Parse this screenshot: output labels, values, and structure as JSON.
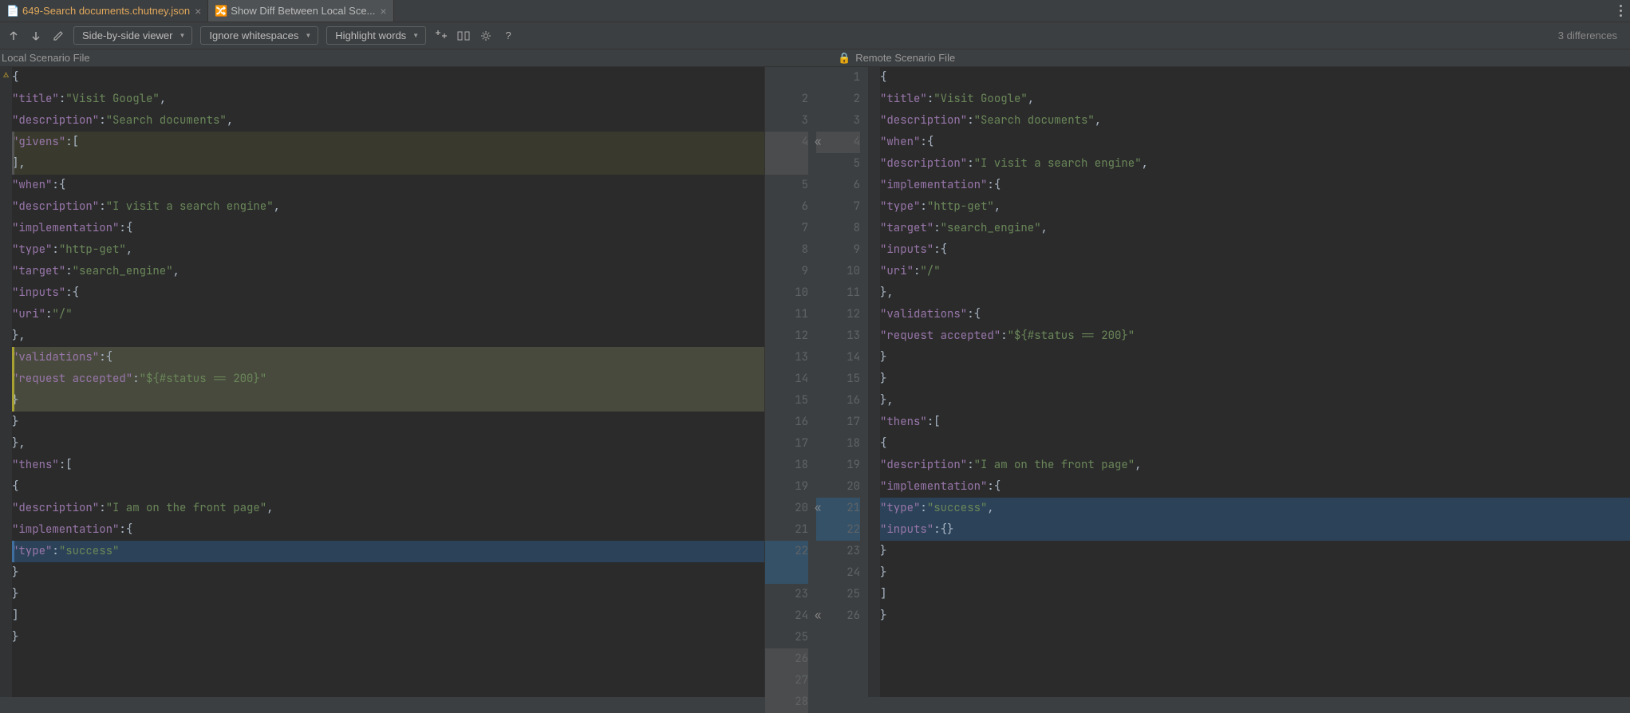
{
  "tabs": [
    {
      "label": "649-Search documents.chutney.json",
      "active": false
    },
    {
      "label": "Show Diff Between Local Sce...",
      "active": true
    }
  ],
  "toolbar": {
    "prev_diff": "↑",
    "next_diff": "↓",
    "viewer_select": "Side-by-side viewer",
    "whitespace_select": "Ignore whitespaces",
    "highlight_select": "Highlight words"
  },
  "diff_count": "3 differences",
  "headers": {
    "left": "Local Scenario File",
    "right": "Remote Scenario File",
    "lock_icon": "🔒"
  },
  "left_lines": [
    {
      "text": "{"
    },
    {
      "text": "    \"title\": \"Visit Google\","
    },
    {
      "text": "    \"description\": \"Search documents\","
    },
    {
      "text": "    \"givens\": [",
      "hl": "yolite"
    },
    {
      "text": "    ],",
      "hl": "yolite"
    },
    {
      "text": "    \"when\": {"
    },
    {
      "text": "        \"description\": \"I visit a search engine\","
    },
    {
      "text": "        \"implementation\": {"
    },
    {
      "text": "            \"type\": \"http-get\","
    },
    {
      "text": "            \"target\": \"search_engine\","
    },
    {
      "text": "            \"inputs\": {"
    },
    {
      "text": "                \"uri\": \"/\""
    },
    {
      "text": "            },"
    },
    {
      "text": "            \"validations\": {",
      "hl": "yellow"
    },
    {
      "text": "                \"request accepted\": \"${#status == 200}\"",
      "hl": "yellow"
    },
    {
      "text": "            }",
      "hl": "yellow"
    },
    {
      "text": "        }"
    },
    {
      "text": "    },"
    },
    {
      "text": "    \"thens\": ["
    },
    {
      "text": "        {"
    },
    {
      "text": "            \"description\": \"I am on the front page\","
    },
    {
      "text": "            \"implementation\": {"
    },
    {
      "text": "                \"type\": \"success\"",
      "hl": "blue"
    },
    {
      "text": "            }"
    },
    {
      "text": "        }"
    },
    {
      "text": "    ]"
    },
    {
      "text": "}"
    }
  ],
  "gutter": {
    "right_of_left": [
      "",
      "2",
      "3",
      "4",
      "",
      "5",
      "6",
      "7",
      "8",
      "9",
      "10",
      "11",
      "12",
      "13",
      "14",
      "15",
      "16",
      "17",
      "18",
      "19",
      "20",
      "21",
      "22",
      "",
      "23",
      "24",
      "25",
      "26",
      "27",
      "28"
    ],
    "left_of_right": [
      "1",
      "2",
      "3",
      "4",
      "5",
      "6",
      "7",
      "8",
      "9",
      "10",
      "11",
      "12",
      "13",
      "14",
      "15",
      "16",
      "17",
      "18",
      "19",
      "20",
      "21",
      "22",
      "23",
      "24",
      "25",
      "26"
    ]
  },
  "right_lines": [
    {
      "text": "{"
    },
    {
      "text": "    \"title\": \"Visit Google\","
    },
    {
      "text": "    \"description\": \"Search documents\","
    },
    {
      "text": "    \"when\": {"
    },
    {
      "text": "        \"description\": \"I visit a search engine\","
    },
    {
      "text": "        \"implementation\": {"
    },
    {
      "text": "            \"type\": \"http-get\","
    },
    {
      "text": "            \"target\": \"search_engine\","
    },
    {
      "text": "            \"inputs\": {"
    },
    {
      "text": "                \"uri\": \"/\""
    },
    {
      "text": "            },"
    },
    {
      "text": "            \"validations\": {"
    },
    {
      "text": "                \"request accepted\": \"${#status == 200}\""
    },
    {
      "text": "            }"
    },
    {
      "text": "        }"
    },
    {
      "text": "    },"
    },
    {
      "text": "    \"thens\": ["
    },
    {
      "text": "        {"
    },
    {
      "text": "            \"description\": \"I am on the front page\","
    },
    {
      "text": "            \"implementation\": {"
    },
    {
      "text": "                \"type\": \"success\",",
      "hl": "blue"
    },
    {
      "text": "                \"inputs\": {}",
      "hl": "blue"
    },
    {
      "text": "            }"
    },
    {
      "text": "        }"
    },
    {
      "text": "    ]"
    },
    {
      "text": "}"
    }
  ]
}
